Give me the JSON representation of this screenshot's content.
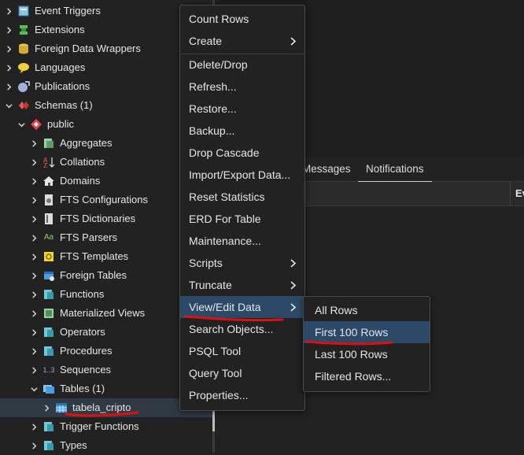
{
  "tree": {
    "items": [
      {
        "label": "Event Triggers",
        "icon": "event-trigger-icon",
        "expanded": false
      },
      {
        "label": "Extensions",
        "icon": "extension-icon",
        "expanded": false
      },
      {
        "label": "Foreign Data Wrappers",
        "icon": "foreign-data-wrapper-icon",
        "expanded": false
      },
      {
        "label": "Languages",
        "icon": "language-icon",
        "expanded": false
      },
      {
        "label": "Publications",
        "icon": "publication-icon",
        "expanded": false
      },
      {
        "label": "Schemas (1)",
        "icon": "schema-icon",
        "expanded": true
      },
      {
        "label": "public",
        "icon": "public-schema-icon",
        "expanded": true
      },
      {
        "label": "Aggregates",
        "icon": "aggregate-icon",
        "expanded": false
      },
      {
        "label": "Collations",
        "icon": "collation-icon",
        "expanded": false
      },
      {
        "label": "Domains",
        "icon": "domain-icon",
        "expanded": false
      },
      {
        "label": "FTS Configurations",
        "icon": "fts-configuration-icon",
        "expanded": false
      },
      {
        "label": "FTS Dictionaries",
        "icon": "fts-dictionary-icon",
        "expanded": false
      },
      {
        "label": "FTS Parsers",
        "icon": "fts-parser-icon",
        "glyph": "Aa",
        "expanded": false
      },
      {
        "label": "FTS Templates",
        "icon": "fts-template-icon",
        "expanded": false
      },
      {
        "label": "Foreign Tables",
        "icon": "foreign-table-icon",
        "expanded": false
      },
      {
        "label": "Functions",
        "icon": "function-icon",
        "expanded": false
      },
      {
        "label": "Materialized Views",
        "icon": "materialized-view-icon",
        "expanded": false
      },
      {
        "label": "Operators",
        "icon": "operator-icon",
        "expanded": false
      },
      {
        "label": "Procedures",
        "icon": "procedure-icon",
        "expanded": false
      },
      {
        "label": "Sequences",
        "icon": "sequence-icon",
        "glyph": "1..3",
        "expanded": false
      },
      {
        "label": "Tables (1)",
        "icon": "table-group-icon",
        "expanded": true
      },
      {
        "label": "tabela_cripto",
        "icon": "table-icon",
        "expanded": false,
        "selected": true
      },
      {
        "label": "Trigger Functions",
        "icon": "trigger-function-icon",
        "expanded": false
      },
      {
        "label": "Types",
        "icon": "type-icon",
        "expanded": false
      }
    ]
  },
  "panel": {
    "tabs": [
      {
        "label": "Messages",
        "active": false
      },
      {
        "label": "Notifications",
        "active": true
      }
    ],
    "grid_header_col": "Ev"
  },
  "context_menu": {
    "items": [
      {
        "label": "Count Rows",
        "submenu": false
      },
      {
        "label": "Create",
        "submenu": true
      },
      {
        "label": "Delete/Drop",
        "submenu": false
      },
      {
        "label": "Refresh...",
        "submenu": false
      },
      {
        "label": "Restore...",
        "submenu": false
      },
      {
        "label": "Backup...",
        "submenu": false
      },
      {
        "label": "Drop Cascade",
        "submenu": false
      },
      {
        "label": "Import/Export Data...",
        "submenu": false
      },
      {
        "label": "Reset Statistics",
        "submenu": false
      },
      {
        "label": "ERD For Table",
        "submenu": false
      },
      {
        "label": "Maintenance...",
        "submenu": false
      },
      {
        "label": "Scripts",
        "submenu": true
      },
      {
        "label": "Truncate",
        "submenu": true
      },
      {
        "label": "View/Edit Data",
        "submenu": true,
        "highlighted": true
      },
      {
        "label": "Search Objects...",
        "submenu": false
      },
      {
        "label": "PSQL Tool",
        "submenu": false
      },
      {
        "label": "Query Tool",
        "submenu": false
      },
      {
        "label": "Properties...",
        "submenu": false
      }
    ]
  },
  "submenu": {
    "items": [
      {
        "label": "All Rows"
      },
      {
        "label": "First 100 Rows",
        "highlighted": true
      },
      {
        "label": "Last 100 Rows"
      },
      {
        "label": "Filtered Rows..."
      }
    ]
  },
  "colors": {
    "background": "#222222",
    "highlight": "#2c4a68",
    "annotation_red": "#e01010"
  }
}
